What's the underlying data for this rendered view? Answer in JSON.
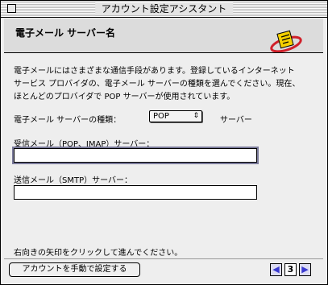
{
  "window": {
    "title": "アカウント設定アシスタント"
  },
  "header": {
    "title": "電子メール サーバー名",
    "icon": "mail-icon"
  },
  "description": "電子メールにはさまざまな通信手段があります。登録しているインターネット\nサービス プロバイダの、電子メール サーバーの種類を選んでください。現在、\nほとんどのプロバイダで POP サーバーが使用されています。",
  "server_type": {
    "label": "電子メール サーバーの種類：",
    "selected": "POP",
    "suffix": "サーバー"
  },
  "incoming": {
    "label": "受信メール（POP、IMAP）サーバー：",
    "value": ""
  },
  "outgoing": {
    "label": "送信メール（SMTP）サーバー：",
    "value": ""
  },
  "instruction": "右向きの矢印をクリックして進んでください。",
  "footer": {
    "manual_button": "アカウントを手動で設定する",
    "prev": "◀",
    "page": "3",
    "next": "▶"
  }
}
